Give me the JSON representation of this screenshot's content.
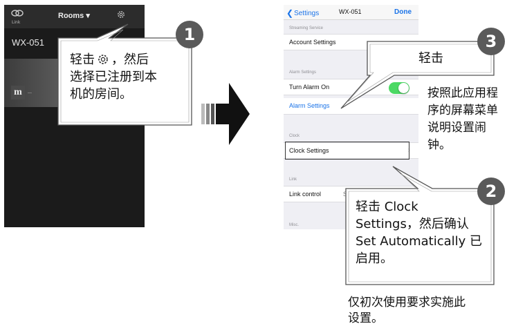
{
  "left_app": {
    "link_label": "Link",
    "rooms_label": "Rooms ▾",
    "room_name": "WX-051",
    "thumb_glyph": "m",
    "link_icon": "link-icon",
    "gear_icon": "gear-icon"
  },
  "right_app": {
    "nav": {
      "back_label": "Settings",
      "title": "WX-051",
      "done_label": "Done"
    },
    "sections": {
      "streaming": "Streaming Service",
      "alarm": "Alarm Settings",
      "clock": "Clock",
      "link": "Link",
      "misc": "Misc."
    },
    "cells": {
      "account_settings": "Account Settings",
      "turn_alarm_on": "Turn Alarm On",
      "alarm_settings": "Alarm Settings",
      "clock_settings": "Clock Settings",
      "link_control": "Link control",
      "link_control_value": "S"
    },
    "alarm_toggle_on": true
  },
  "callouts": {
    "c1": {
      "number": "1",
      "line1_a": "轻击",
      "line1_b": "，然后",
      "line2": "选择已注册到本",
      "line3": "机的房间。"
    },
    "c2": {
      "number": "2",
      "line1": "轻击 Clock",
      "line2": "Settings，然后确认",
      "line3": "Set Automatically 已",
      "line4": "启用。"
    },
    "c3": {
      "number": "3",
      "text": "轻击"
    }
  },
  "notes": {
    "right": [
      "按照此应用程",
      "序的屏幕菜单",
      "说明设置闹",
      "钟。"
    ],
    "bottom": [
      "仅初次使用要求实施此",
      "设置。"
    ]
  },
  "colors": {
    "toggle_on": "#4cd964",
    "ios_blue": "#1a73e8",
    "badge": "#5a5a5a"
  }
}
